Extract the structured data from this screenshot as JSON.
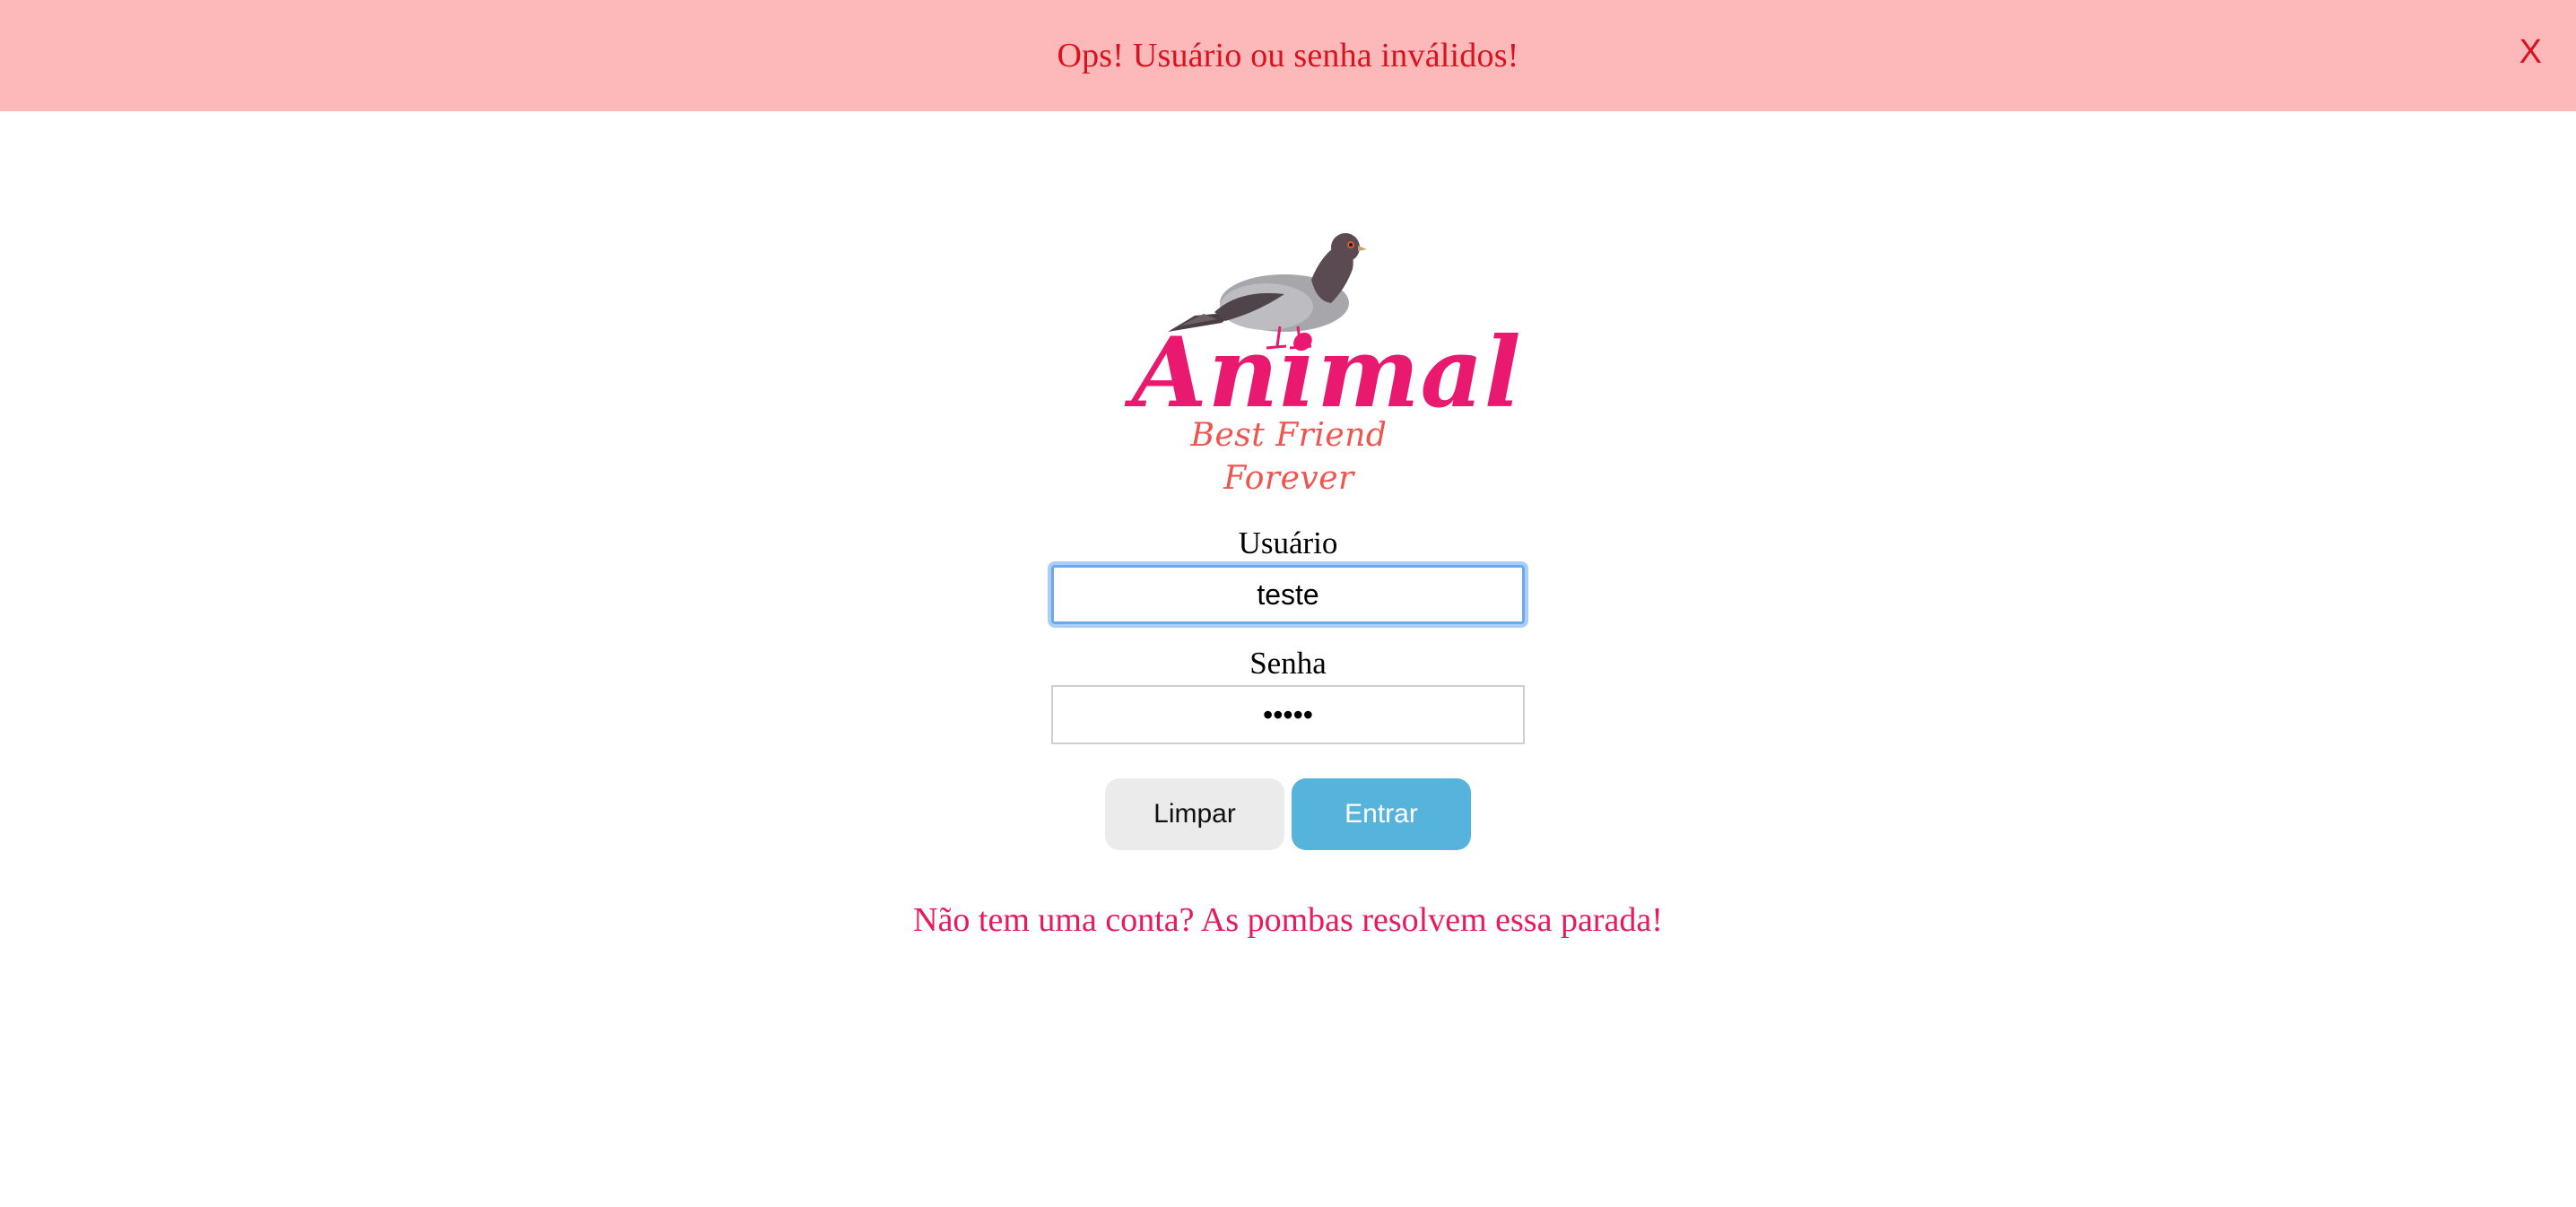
{
  "alert": {
    "message": "Ops! Usuário ou senha inválidos!",
    "close_label": "X"
  },
  "logo": {
    "word": "Animal",
    "tagline": "Best Friend Forever",
    "image_icon": "pigeon-icon"
  },
  "form": {
    "user_label": "Usuário",
    "user_value": "teste",
    "password_label": "Senha",
    "password_value": "•••••"
  },
  "buttons": {
    "clear_label": "Limpar",
    "enter_label": "Entrar"
  },
  "signup_text": "Não tem uma conta? As pombas resolvem essa parada!",
  "colors": {
    "alert_bg": "#fdb9b9",
    "alert_text": "#d8121f",
    "brand_pink": "#e8196e",
    "tagline": "#f0544f",
    "enter_button": "#56b3dc",
    "clear_button": "#ebebeb",
    "focus_ring": "#6aa9f0"
  }
}
